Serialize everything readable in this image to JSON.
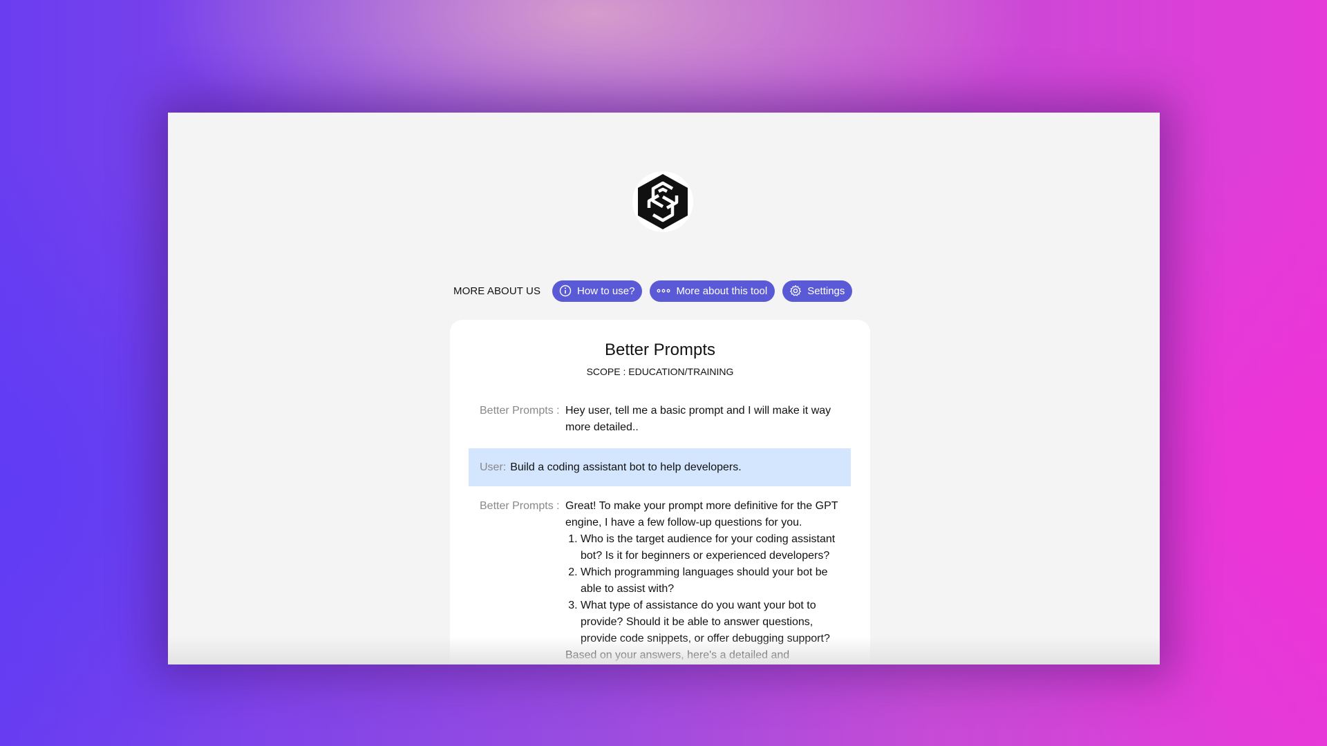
{
  "nav": {
    "label": "MORE ABOUT US",
    "buttons": [
      {
        "label": "How to use?",
        "icon": "info-icon"
      },
      {
        "label": "More about this tool",
        "icon": "more-dots-icon"
      },
      {
        "label": "Settings",
        "icon": "gear-icon"
      }
    ]
  },
  "card": {
    "title": "Better Prompts",
    "scope": "SCOPE : EDUCATION/TRAINING"
  },
  "messages": [
    {
      "speaker": "Better Prompts :",
      "text": "Hey user, tell me a basic prompt and I will make it way more detailed.."
    },
    {
      "speaker": "User:",
      "text": "Build a coding assistant bot to help developers."
    },
    {
      "speaker": "Better Prompts :",
      "intro": "Great! To make your prompt more definitive for the GPT engine, I have a few follow-up questions for you.",
      "questions": [
        "Who is the target audience for your coding assistant bot? Is it for beginners or experienced developers?",
        "Which programming languages should your bot be able to assist with?",
        "What type of assistance do you want your bot to provide? Should it be able to answer questions, provide code snippets, or offer debugging support?"
      ],
      "outro": "Based on your answers, here's a detailed and"
    }
  ],
  "colors": {
    "accent": "#5a5ad6",
    "user_bubble": "#d3e6fd"
  }
}
